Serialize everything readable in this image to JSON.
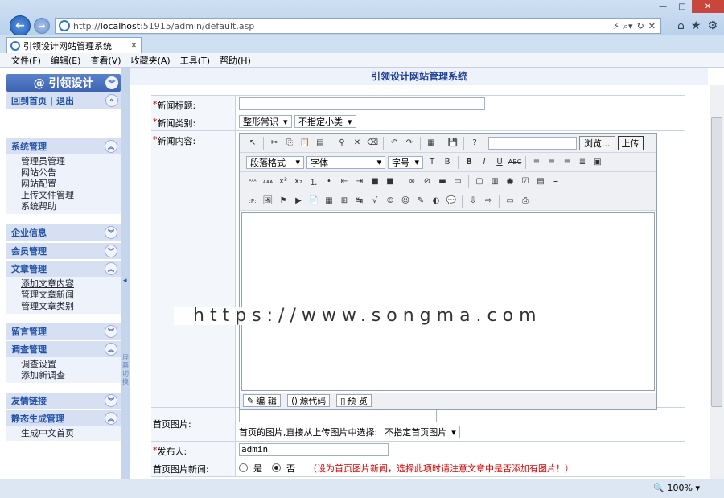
{
  "browser": {
    "url_prefix": "http://",
    "url_host": "localhost",
    "url_rest": ":51915/admin/default.asp",
    "tab_title": "引领设计网站管理系统",
    "menu": [
      "文件(F)",
      "编辑(E)",
      "查看(V)",
      "收藏夹(A)",
      "工具(T)",
      "帮助(H)"
    ],
    "zoom": "100%"
  },
  "sidebar": {
    "logo": "@ 引领设计",
    "home": "回到首页",
    "divider": "|",
    "logout": "退出",
    "groups": [
      {
        "title": "系统管理",
        "items": [
          "管理员管理",
          "网站公告",
          "网站配置",
          "上传文件管理",
          "系统帮助"
        ]
      },
      {
        "title": "企业信息",
        "items": []
      },
      {
        "title": "会员管理",
        "items": []
      },
      {
        "title": "文章管理",
        "items": [
          "添加文章内容",
          "管理文章新闻",
          "管理文章类别"
        ]
      },
      {
        "title": "留言管理",
        "items": []
      },
      {
        "title": "调查管理",
        "items": [
          "调查设置",
          "添加新调查"
        ]
      },
      {
        "title": "友情链接",
        "items": []
      },
      {
        "title": "静态生成管理",
        "items": [
          "生成中文首页"
        ]
      }
    ],
    "splitter_text": "屏幕切换"
  },
  "main": {
    "title": "引领设计网站管理系统",
    "fields": {
      "news_title_label": "新闻标题:",
      "category_label": "新闻类别:",
      "category_value": "整形常识",
      "subcategory_value": "不指定小类",
      "content_label": "新闻内容:",
      "home_image_label": "首页图片:",
      "home_image_hint": "首页的图片,直接从上传图片中选择:",
      "home_image_select": "不指定首页图片",
      "publisher_label": "发布人:",
      "publisher_value": "admin",
      "home_news_label": "首页图片新闻:",
      "yes": "是",
      "no": "否",
      "note": "（设为首页图片新闻，选择此项时请注意文章中是否添加有图片！）"
    },
    "editor": {
      "browse": "浏览...",
      "upload": "上传",
      "paragraph": "段落格式",
      "font": "字体",
      "size": "字号",
      "mode_edit": "编 辑",
      "mode_source": "源代码",
      "mode_preview": "预 览"
    }
  },
  "watermark": "https://www.songma.com"
}
